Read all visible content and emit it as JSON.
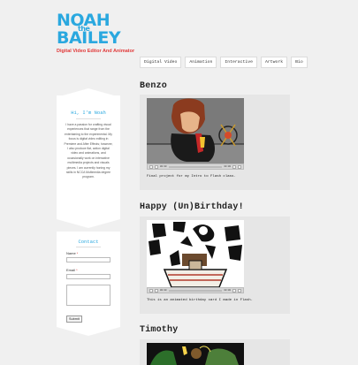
{
  "header": {
    "logo_line1": "NOAH",
    "logo_line2": "the",
    "logo_line3": "BAILEY",
    "tagline": "Digital Video Editor And Animator"
  },
  "nav": {
    "items": [
      {
        "label": "Digital Video"
      },
      {
        "label": "Animation"
      },
      {
        "label": "Interactive"
      },
      {
        "label": "Artwork"
      },
      {
        "label": "Bio"
      }
    ]
  },
  "about": {
    "title": "Hi, I'm Noah",
    "text": "I have a passion for crafting visual experiences that range from the entertaining to the experimental. My focus is digital video editing in Premiere and After Effects; however, I also produce flat, action digital video and animations, and occasionally work on interactive multimedia projects and visuals pieces. I am currently honing my skills in NCCA Multimedia degree program."
  },
  "contact": {
    "title": "Contact",
    "name_label": "Name",
    "email_label": "Email",
    "required_mark": "*",
    "submit_label": "Submit"
  },
  "posts": [
    {
      "title": "Benzo",
      "caption": "Final project for my Intro to Flash class."
    },
    {
      "title": "Happy (Un)Birthday!",
      "caption": "This is an animated birthday card I made in Flash."
    },
    {
      "title": "Timothy"
    }
  ],
  "video_controls": {
    "time_current": "00:00",
    "time_total": "00:00"
  },
  "colors": {
    "accent_blue": "#2aa8df",
    "accent_red": "#e13a3a",
    "background": "#f0f0f0"
  }
}
